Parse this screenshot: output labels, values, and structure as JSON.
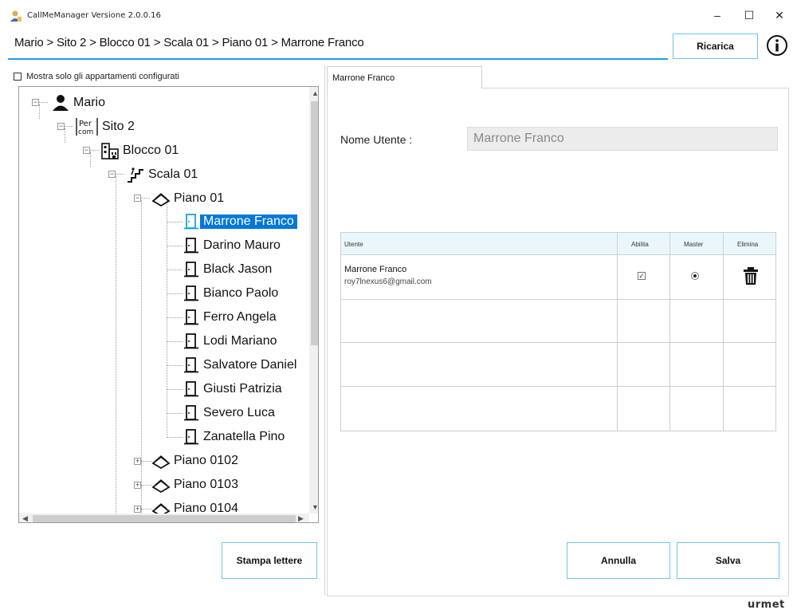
{
  "window": {
    "title": "CallMeManager Versione 2.0.0.16",
    "minimize": "–",
    "maximize": "☐",
    "close": "✕"
  },
  "breadcrumb": "Mario > Sito 2 > Blocco 01 > Scala 01 > Piano 01 > Marrone Franco",
  "toolbar": {
    "reload_label": "Ricarica",
    "info_icon": "info-icon"
  },
  "left": {
    "only_configured_label": "Mostra solo gli appartamenti configurati",
    "print_button": "Stampa lettere",
    "tree": {
      "root": "Mario",
      "site": "Sito 2",
      "block": "Blocco 01",
      "stair": "Scala 01",
      "floor": "Piano 01",
      "apartments": [
        "Marrone Franco",
        "Darino Mauro",
        "Black Jason",
        "Bianco Paolo",
        "Ferro Angela",
        "Lodi Mariano",
        "Salvatore Daniel",
        "Giusti Patrizia",
        "Severo Luca",
        "Zanatella Pino"
      ],
      "other_floors": [
        "Piano 0102",
        "Piano 0103",
        "Piano 0104"
      ],
      "selected": "Marrone Franco"
    }
  },
  "right": {
    "tab_label": "Marrone Franco",
    "user_name_label": "Nome Utente :",
    "user_name_value": "Marrone Franco",
    "grid": {
      "headers": [
        "Utente",
        "Abilita",
        "Master",
        "Elimina"
      ],
      "rows": [
        {
          "name": "Marrone Franco",
          "email": "roy7lnexus6@gmail.com",
          "enabled": true,
          "master": true
        }
      ]
    },
    "cancel_button": "Annulla",
    "save_button": "Salva"
  },
  "brand": "urmet",
  "colors": {
    "accent": "#1ba1e2",
    "selection": "#0078d7",
    "button_border": "#6cc6ea"
  }
}
